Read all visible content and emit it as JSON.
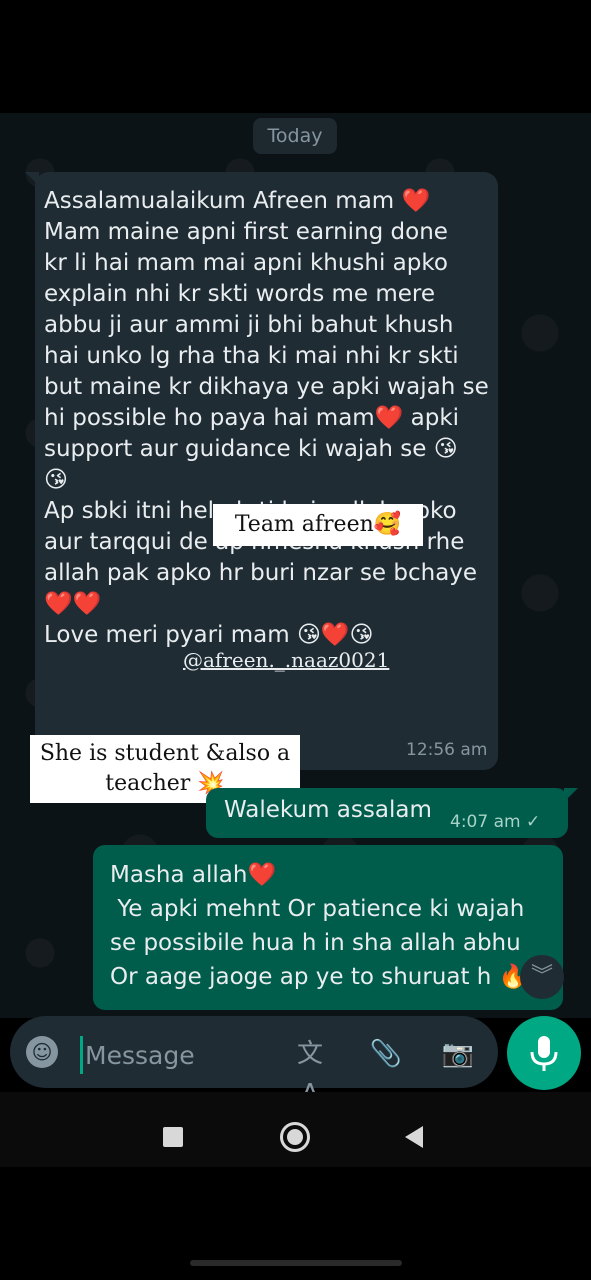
{
  "date_separator": "Today",
  "incoming": {
    "text": "Assalamualaikum Afreen mam ❤️\nMam maine apni first earning done\nkr li hai mam mai apni khushi apko\nexplain nhi kr skti words me mere\nabbu ji aur ammi ji bhi bahut khush\nhai unko lg rha tha ki mai nhi kr skti\nbut maine kr dikhaya ye apki wajah se\nhi possible ho paya hai mam❤️ apki\nsupport aur guidance ki wajah se 😘\n😘\nAp sbki itni help krti hain allah apko\naur tarqqui de ap hmesha khush rhe\nallah pak apko hr buri nzar se bchaye\n❤️❤️\nLove meri pyari mam 😘❤️😘",
    "time": "12:56 am"
  },
  "overlays": {
    "team_label": "Team afreen🥰",
    "handle": "@afreen._.naaz0021",
    "student_note": "She is student &also a teacher 💥"
  },
  "outgoing": [
    {
      "text": "Walekum assalam",
      "time": "4:07 am ✓"
    },
    {
      "text": "Masha allah❤️\n Ye apki mehnt Or patience ki wajah\nse possibile hua h in sha allah abhu\nOr aage jaoge ap ye to shuruat h 🔥"
    }
  ],
  "input_bar": {
    "placeholder": "Message",
    "emoji_icon": "☺",
    "translate_icon": "文A",
    "attach_icon": "📎",
    "camera_icon": "📷"
  },
  "colors": {
    "incoming_bubble": "#1f2c34",
    "outgoing_bubble": "#005c4b",
    "accent": "#00a884",
    "background": "#0c1317"
  }
}
